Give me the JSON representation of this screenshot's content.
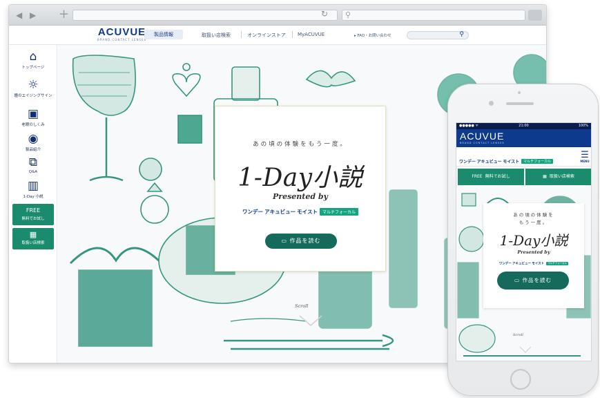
{
  "colors": {
    "brand_navy": "#0e3a8e",
    "accent_green": "#1a8c6d",
    "button_dark_green": "#156a5c",
    "badge_green": "#12a57f",
    "illustration_green": "#1f8a72"
  },
  "desktop": {
    "brand": {
      "name": "ACUVUE",
      "sub": "BRAND CONTACT LENSES"
    },
    "nav": [
      {
        "label": "製品情報"
      },
      {
        "label": "取扱い店検索"
      },
      {
        "label": "オンラインストア"
      },
      {
        "label": "MyACUVUE"
      },
      {
        "label": "▸ FAQ・お問い合わせ"
      }
    ],
    "sidebar": [
      {
        "icon": "home-icon",
        "label": "トップページ"
      },
      {
        "icon": "lightbulb-icon",
        "label": "瞳のエイジングサイン"
      },
      {
        "icon": "film-icon",
        "label": "老眼のしくみ"
      },
      {
        "icon": "eye-icon",
        "label": "製品紹介"
      },
      {
        "icon": "chat-icon",
        "label": "Q&A"
      },
      {
        "icon": "book-icon",
        "label": "1-Day 小説"
      }
    ],
    "cta_free": {
      "icon": "FREE",
      "label": "無料でお試し"
    },
    "cta_store": {
      "icon": "store-icon",
      "label": "取扱い店検索"
    },
    "hero": {
      "tagline": "あの頃の体験をもう一度。",
      "title": "1-Day小説",
      "presented_by": "Presented by",
      "product_name": "ワンデー アキュビュー モイスト",
      "product_badge": "マルチフォーカル",
      "read_button": "作品を読む",
      "scroll_label": "Scroll"
    }
  },
  "mobile": {
    "status": {
      "signal": "●●●●● ᯤ",
      "time": "21:00",
      "battery": "100%"
    },
    "brand": {
      "name": "ACUVUE",
      "sub": "BRAND CONTACT LENSES"
    },
    "product_name": "ワンデー アキュビュー モイスト",
    "product_badge": "マルチフォーカル",
    "menu_label": "MENU",
    "cta_free": {
      "icon": "FREE",
      "label": "無料でお試し"
    },
    "cta_store": {
      "label": "取扱い店検索"
    },
    "hero": {
      "tagline_line1": "あの頃の体験を",
      "tagline_line2": "もう一度。",
      "title": "1-Day小説",
      "presented_by": "Presented by",
      "read_button": "作品を読む",
      "scroll_label": "Scroll"
    }
  }
}
